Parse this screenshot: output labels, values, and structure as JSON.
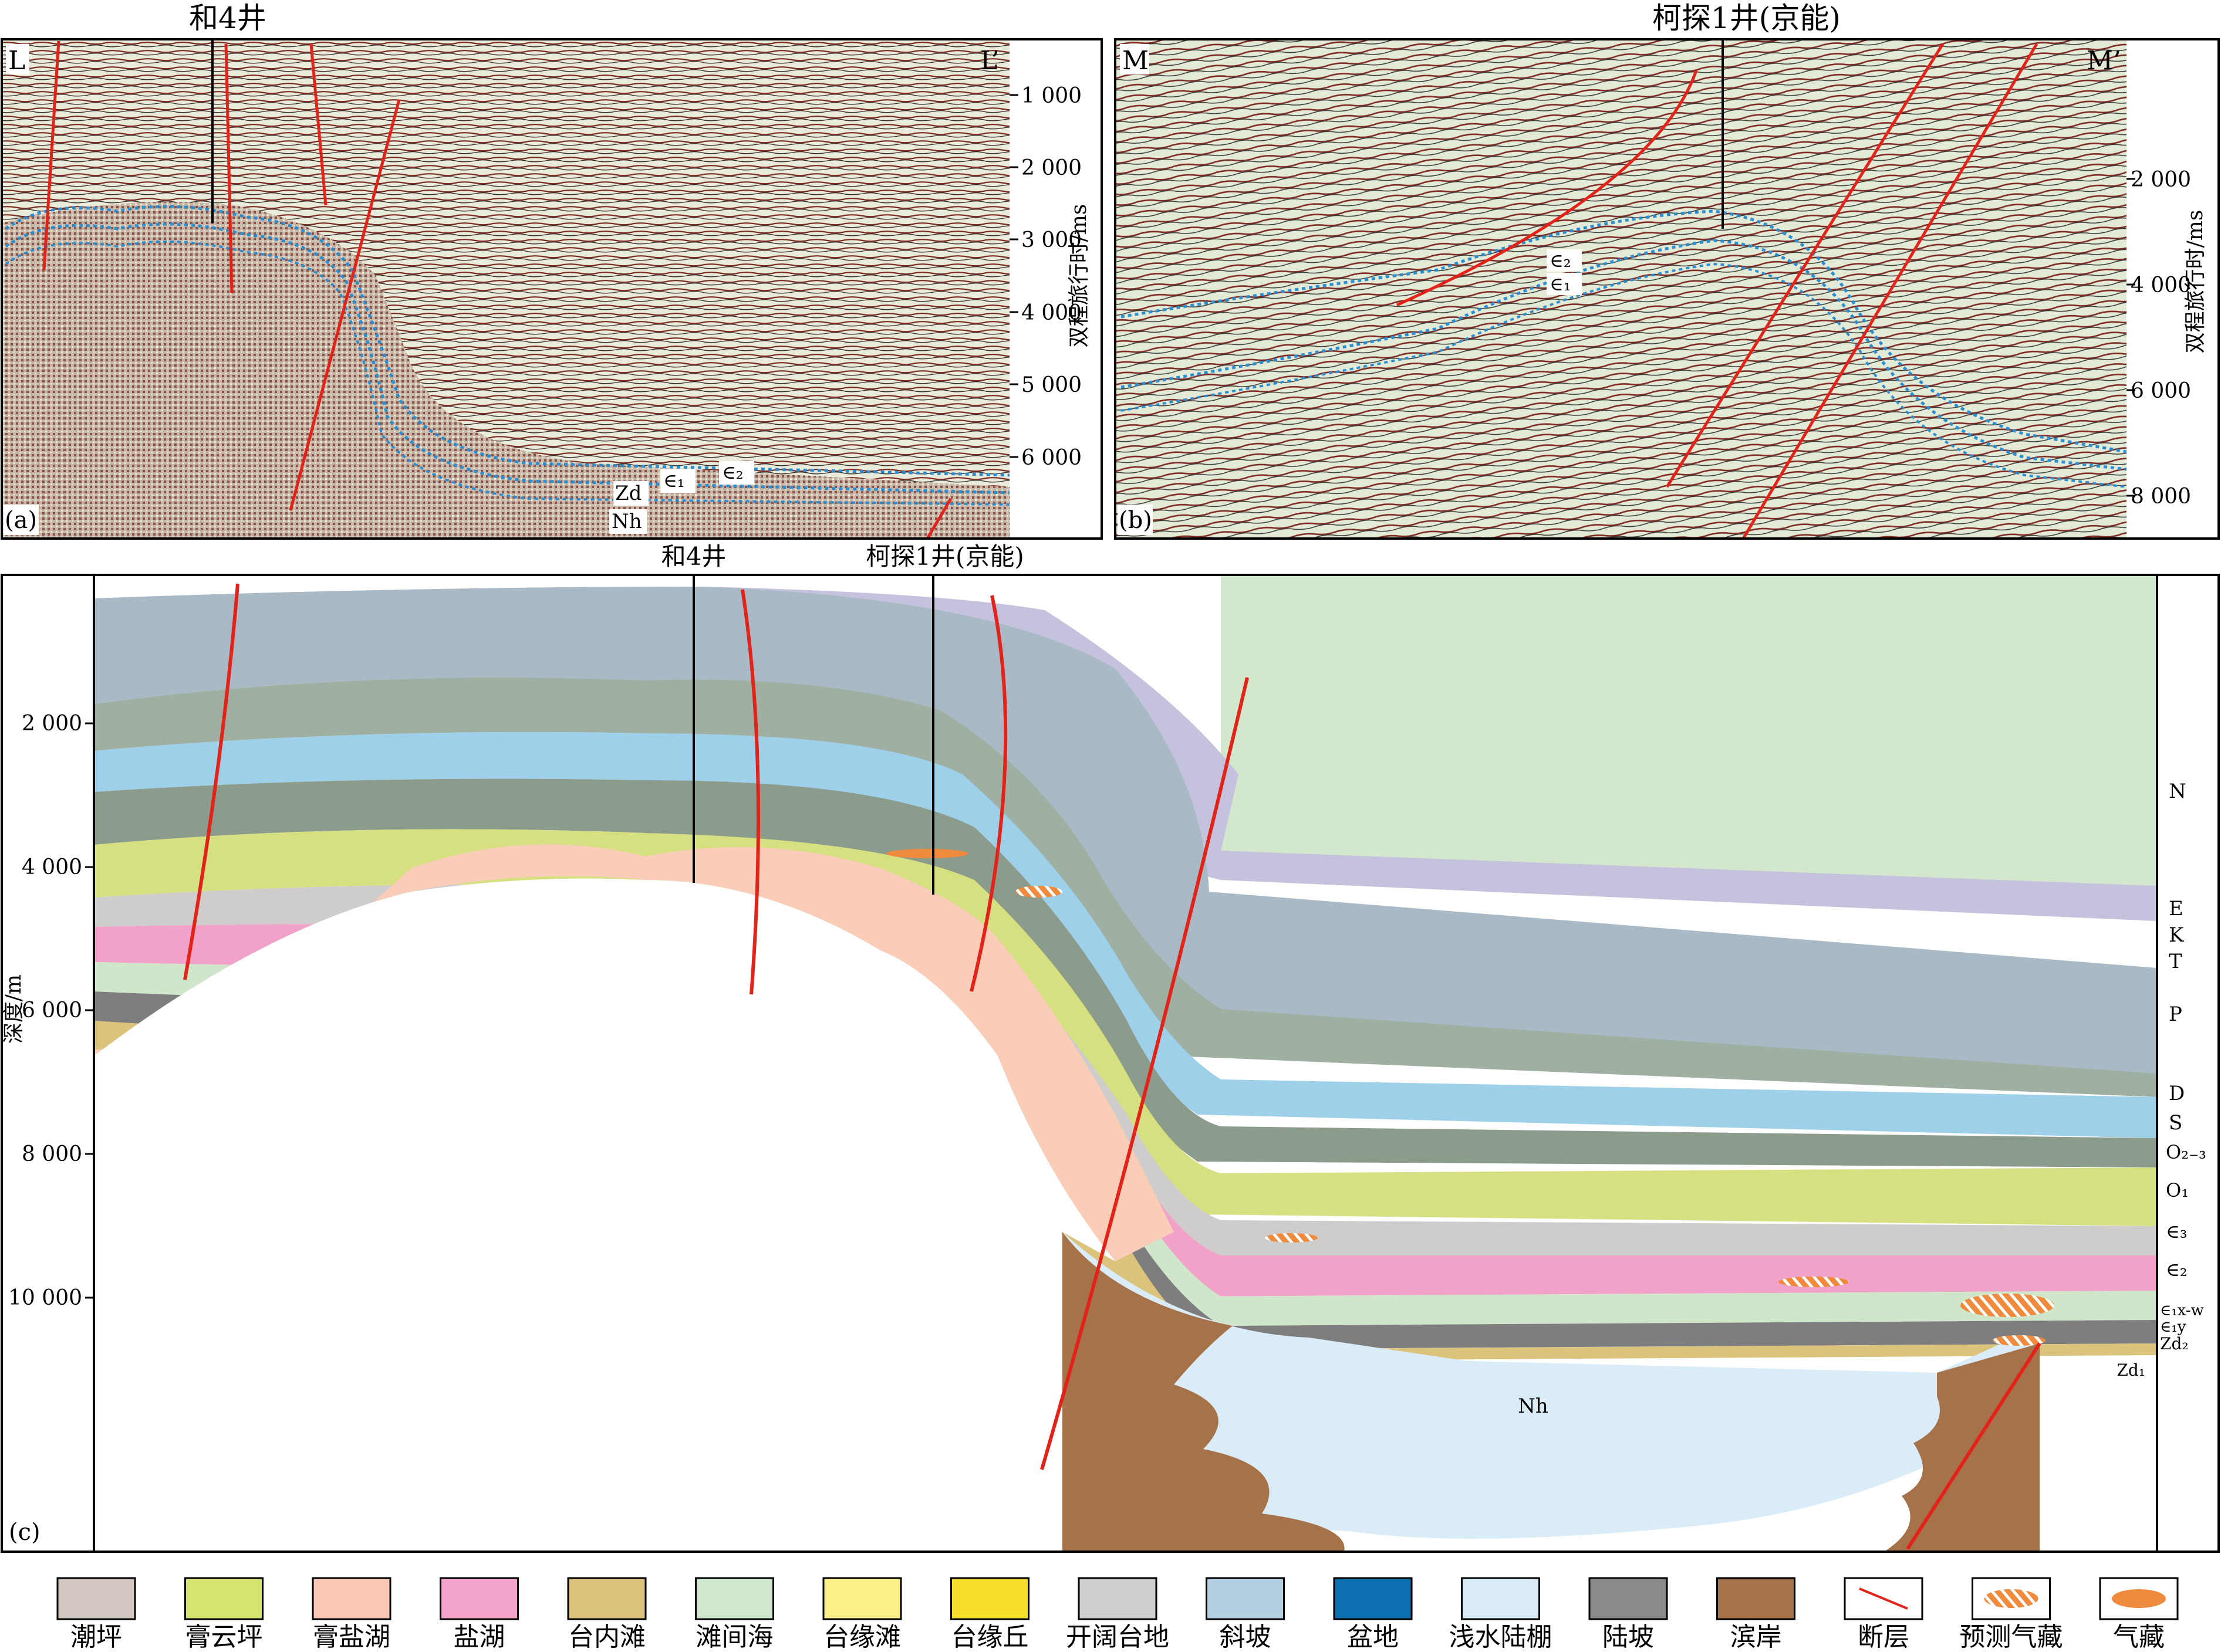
{
  "panel_a": {
    "label": "(a)",
    "corner_left": "L",
    "corner_right": "L’",
    "well": "和4井",
    "axis_title": "双程旅行时/ms",
    "ticks": [
      "1 000",
      "2 000",
      "3 000",
      "4 000",
      "5 000",
      "6 000"
    ],
    "tick_values_ms": [
      1000,
      2000,
      3000,
      4000,
      5000,
      6000
    ],
    "horizons": [
      "∈₂",
      "∈₁",
      "Zd",
      "Nh"
    ]
  },
  "panel_b": {
    "label": "(b)",
    "corner_left": "M",
    "corner_right": "M’",
    "well": "柯探1井(京能)",
    "axis_title": "双程旅行时/ms",
    "ticks": [
      "2 000",
      "4 000",
      "6 000",
      "8 000"
    ],
    "tick_values_ms": [
      2000,
      4000,
      6000,
      8000
    ],
    "horizons": [
      "∈₂",
      "∈₁"
    ]
  },
  "panel_c": {
    "label": "(c)",
    "well_1": "和4井",
    "well_2": "柯探1井(京能)",
    "axis_title": "深度/m",
    "ticks": [
      "2 000",
      "4 000",
      "6 000",
      "8 000",
      "10 000"
    ],
    "tick_values_m": [
      2000,
      4000,
      6000,
      8000,
      10000
    ],
    "basement_label": "Nh",
    "strata": [
      "N",
      "E",
      "K",
      "T",
      "P",
      "D",
      "S",
      "O₂₋₃",
      "O₁",
      "∈₃",
      "∈₂",
      "∈₁x-w",
      "∈₁y",
      "Zd₂",
      "Zd₁"
    ]
  },
  "legend": [
    {
      "label": "潮坪",
      "color": "#d3c7c4"
    },
    {
      "label": "膏云坪",
      "color": "#d6e36e"
    },
    {
      "label": "膏盐湖",
      "color": "#f9c9b6"
    },
    {
      "label": "盐湖",
      "color": "#f3a2c9"
    },
    {
      "label": "台内滩",
      "color": "#dcc37c"
    },
    {
      "label": "滩间海",
      "color": "#cfe7cd"
    },
    {
      "label": "台缘滩",
      "color": "#fbf188"
    },
    {
      "label": "台缘丘",
      "color": "#f5df2a"
    },
    {
      "label": "开阔台地",
      "color": "#cfcfcf"
    },
    {
      "label": "斜坡",
      "color": "#b3cfe2"
    },
    {
      "label": "盆地",
      "color": "#0c6fb0"
    },
    {
      "label": "浅水陆棚",
      "color": "#d9ecf7"
    },
    {
      "label": "陆坡",
      "color": "#8a8a8a"
    },
    {
      "label": "滨岸",
      "color": "#a67249"
    },
    {
      "label": "断层",
      "color": "#e32219"
    },
    {
      "label": "预测气藏",
      "color": "#f08a3c"
    },
    {
      "label": "气藏",
      "color": "#f08a3c"
    }
  ]
}
